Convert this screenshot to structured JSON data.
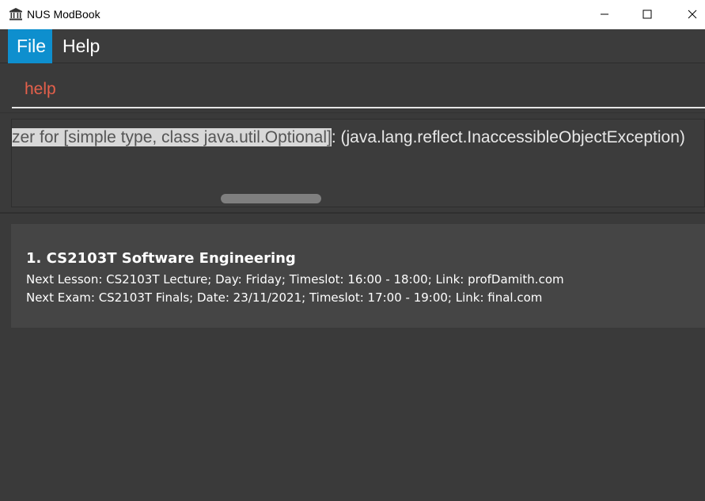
{
  "window": {
    "title": "NUS ModBook",
    "icons": {
      "app": "bank-building-icon",
      "minimize": "minimize-icon",
      "maximize": "maximize-icon",
      "close": "close-icon"
    }
  },
  "menu": {
    "file_label": "File",
    "help_label": "Help",
    "active_color": "#0e8fce"
  },
  "command": {
    "value": "help",
    "text_color": "#e5604b"
  },
  "result": {
    "selected_text": "zer for [simple type, class java.util.Optional]",
    "rest_text": ": (java.lang.reflect.InaccessibleObjectException)"
  },
  "modules": [
    {
      "title": "1.  CS2103T Software Engineering",
      "next_lesson": "Next Lesson: CS2103T Lecture; Day: Friday; Timeslot: 16:00 - 18:00; Link: profDamith.com",
      "next_exam": "Next Exam: CS2103T Finals; Date: 23/11/2021; Timeslot: 17:00 - 19:00; Link: final.com"
    }
  ]
}
